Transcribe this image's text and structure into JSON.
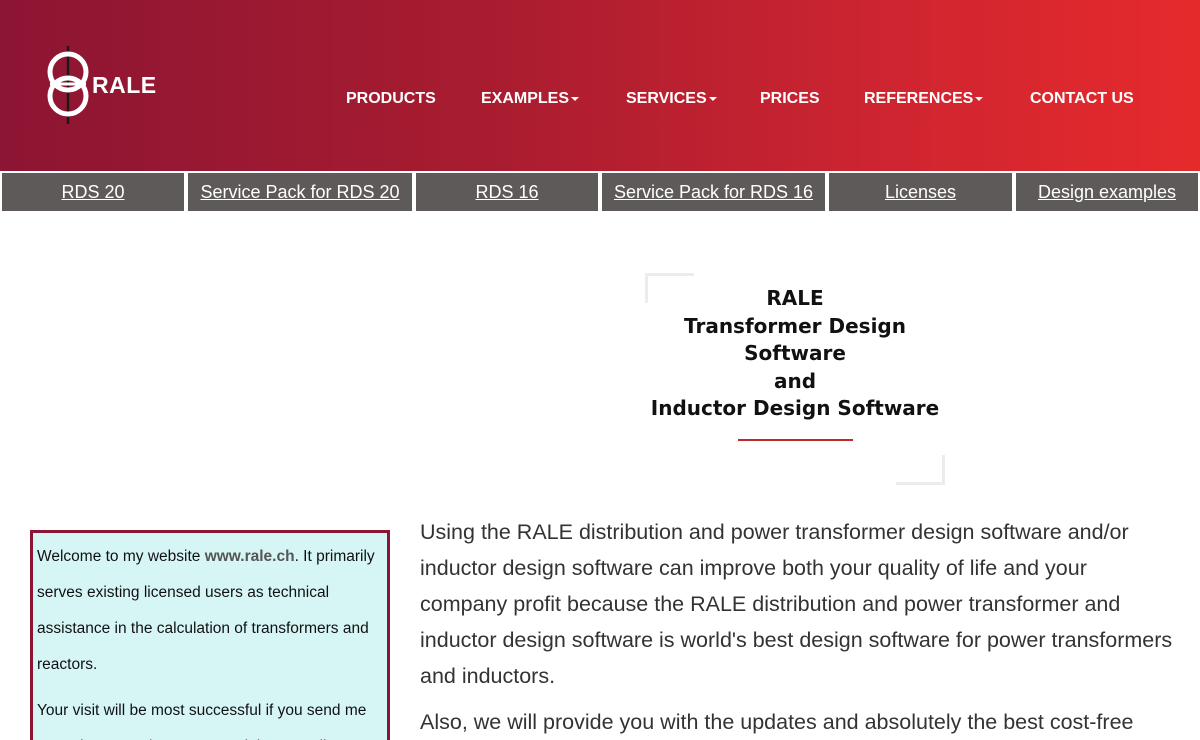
{
  "brand": {
    "name": "RALE"
  },
  "nav": {
    "items": [
      {
        "label": "PRODUCTS",
        "dropdown": false
      },
      {
        "label": "EXAMPLES",
        "dropdown": true
      },
      {
        "label": "SERVICES",
        "dropdown": true
      },
      {
        "label": "PRICES",
        "dropdown": false
      },
      {
        "label": "REFERENCES",
        "dropdown": true
      },
      {
        "label": "CONTACT US",
        "dropdown": false
      }
    ]
  },
  "tabs": [
    {
      "label": "RDS 20"
    },
    {
      "label": "Service Pack for RDS 20"
    },
    {
      "label": "RDS 16"
    },
    {
      "label": "Service Pack for RDS 16"
    },
    {
      "label": "Licenses"
    },
    {
      "label": "Design examples"
    }
  ],
  "title": {
    "line1": "RALE",
    "line2": "Transformer Design",
    "line3": "Software",
    "line4": "and",
    "line5": "Inductor Design Software"
  },
  "welcome": {
    "p1_before": "Welcome to my website ",
    "p1_site": "www.rale.ch",
    "p1_after": ". It primarily serves existing licensed users as technical assistance in the calculation of transformers and reactors.",
    "p2": "Your visit will be most successful if you send me your phone number, name and time to call."
  },
  "main": {
    "p1": "Using the RALE distribution and power transformer design software and/or inductor design software can improve both your quality of life and your company profit because the RALE distribution and power transformer and inductor design software is world's best design software for power transformers and inductors.",
    "p2": "Also, we will provide you with the updates and absolutely the best cost-free support."
  },
  "colors": {
    "header_start": "#8c1533",
    "header_end": "#e62a2c",
    "tab_bg": "#5e5a59",
    "welcome_bg": "#d6f6f6",
    "welcome_border": "#8c1533",
    "accent": "#c0282d"
  },
  "icons": {
    "logo": "transformer-logo-icon",
    "caret": "caret-down-icon"
  }
}
